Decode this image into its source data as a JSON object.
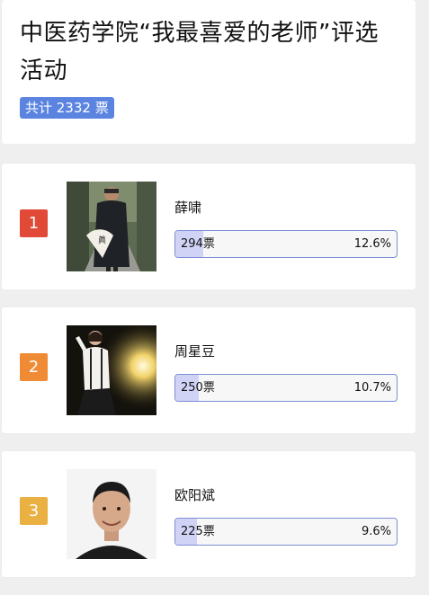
{
  "header": {
    "title": "中医药学院“我最喜爱的老师”评选活动",
    "total_badge": "共计 2332 票"
  },
  "entries": [
    {
      "rank": "1",
      "rank_color": "#e04a36",
      "name": "薛啸",
      "votes": "294票",
      "percent_label": "12.6%",
      "share": 0.126
    },
    {
      "rank": "2",
      "rank_color": "#ef8a35",
      "name": "周星豆",
      "votes": "250票",
      "percent_label": "10.7%",
      "share": 0.107
    },
    {
      "rank": "3",
      "rank_color": "#eab042",
      "name": "欧阳斌",
      "votes": "225票",
      "percent_label": "9.6%",
      "share": 0.096
    }
  ]
}
